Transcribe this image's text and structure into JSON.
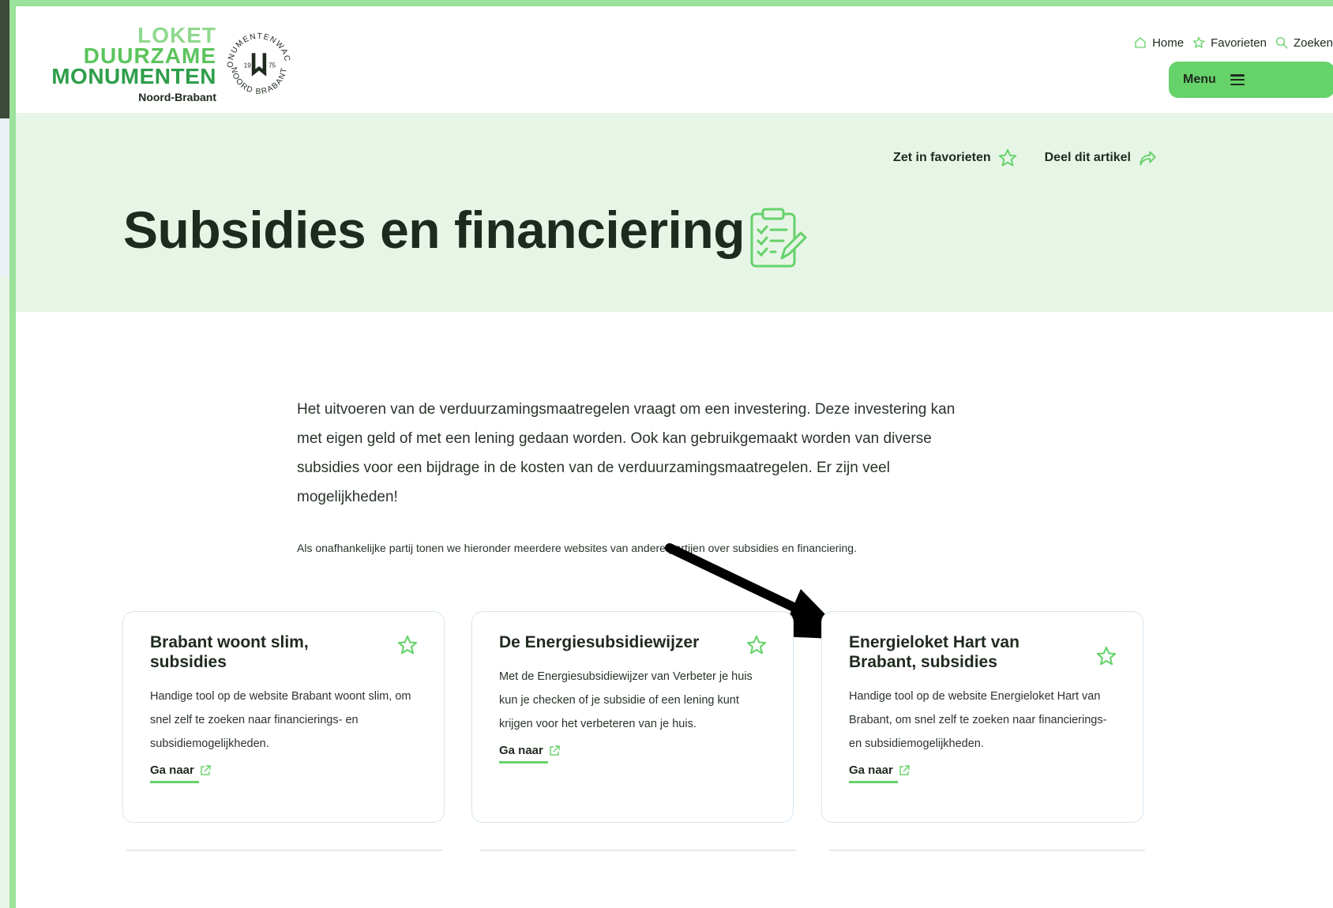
{
  "logo": {
    "line1": "LOKET",
    "line2": "DUURZAME",
    "line3": "MONUMENTEN",
    "line4": "Noord-Brabant",
    "seal_top": "MONUMENTENWACHT",
    "seal_bottom": "NOORD BRABANT",
    "seal_year_left": "19",
    "seal_year_right": "75"
  },
  "topnav": {
    "home": "Home",
    "favorites": "Favorieten",
    "search": "Zoeken"
  },
  "menu": {
    "label": "Menu"
  },
  "hero": {
    "favorite_action": "Zet in favorieten",
    "share_action": "Deel dit artikel",
    "title": "Subsidies en financiering"
  },
  "intro": {
    "text": "Het uitvoeren van de verduurzamingsmaatregelen vraagt om een investering. Deze investering kan met eigen geld of met een lening gedaan worden. Ook kan gebruikgemaakt worden van diverse subsidies voor een bijdrage in de kosten van de verduurzamingsmaatregelen. Er zijn veel mogelijkheden!",
    "note": "Als onafhankelijke partij tonen we hieronder meerdere websites van andere partijen over subsidies en financiering."
  },
  "cards": [
    {
      "title": "Brabant woont slim, subsidies",
      "text": "Handige tool op de website Brabant woont slim, om snel zelf te zoeken naar financierings- en subsidiemogelijkheden.",
      "link": "Ga naar"
    },
    {
      "title": "De Energiesubsidiewijzer",
      "text": "Met de Energiesubsidiewijzer van Verbeter je huis kun je checken of je subsidie of een lening kunt krijgen voor het verbeteren van je huis.",
      "link": "Ga naar"
    },
    {
      "title": "Energieloket Hart van Brabant, subsidies",
      "text": "Handige tool op de website Energieloket Hart van Brabant, om snel zelf te zoeken naar financierings- en subsidiemogelijkheden.",
      "link": "Ga naar"
    }
  ],
  "colors": {
    "accent": "#66d26a",
    "hero_bg": "#e7f5e7",
    "frame": "#9be29b",
    "text": "#1f2a1f"
  }
}
